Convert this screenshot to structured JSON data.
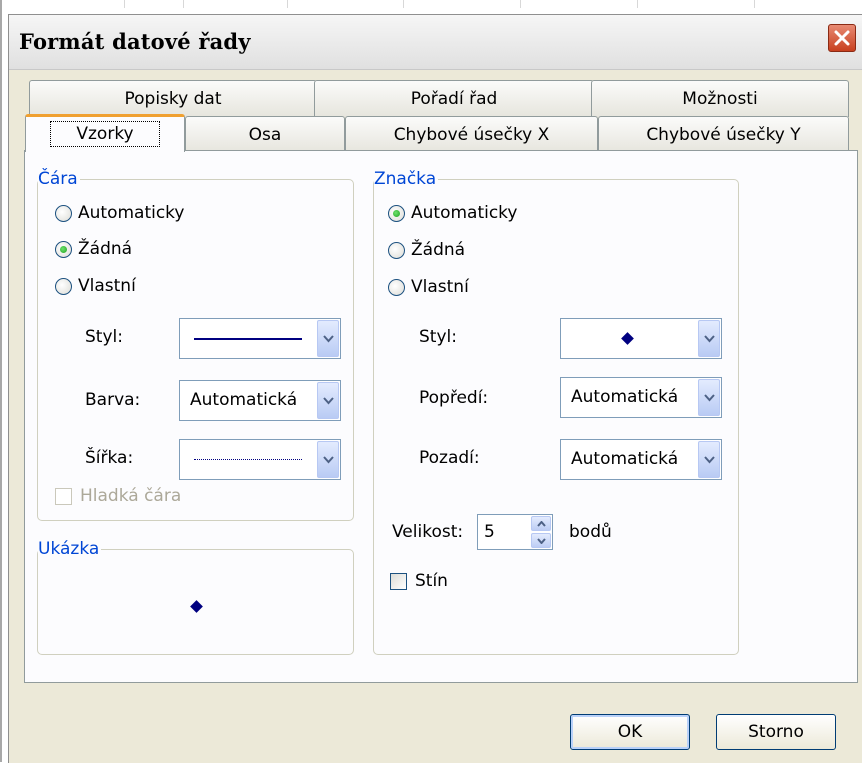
{
  "window": {
    "title": "Formát datové řady",
    "close_icon": "close-icon"
  },
  "tabs": {
    "row1": [
      "Popisky dat",
      "Pořadí řad",
      "Možnosti"
    ],
    "row2": [
      "Vzorky",
      "Osa",
      "Chybové úsečky X",
      "Chybové úsečky Y"
    ],
    "active": "Vzorky"
  },
  "line_group": {
    "title": "Čára",
    "options": [
      "Automaticky",
      "Žádná",
      "Vlastní"
    ],
    "selected": "Žádná",
    "style_label": "Styl:",
    "color_label": "Barva:",
    "color_value": "Automatická",
    "width_label": "Šířka:",
    "smooth_label": "Hladká čára"
  },
  "marker_group": {
    "title": "Značka",
    "options": [
      "Automaticky",
      "Žádná",
      "Vlastní"
    ],
    "selected": "Automaticky",
    "style_label": "Styl:",
    "foreground_label": "Popředí:",
    "foreground_value": "Automatická",
    "background_label": "Pozadí:",
    "background_value": "Automatická",
    "size_label": "Velikost:",
    "size_value": "5",
    "size_unit": "bodů",
    "shadow_label": "Stín"
  },
  "sample_group": {
    "title": "Ukázka"
  },
  "buttons": {
    "ok": "OK",
    "cancel": "Storno"
  },
  "colors": {
    "group_title": "#0046d5",
    "active_tab_accent": "#f0a030",
    "marker": "#000080"
  }
}
